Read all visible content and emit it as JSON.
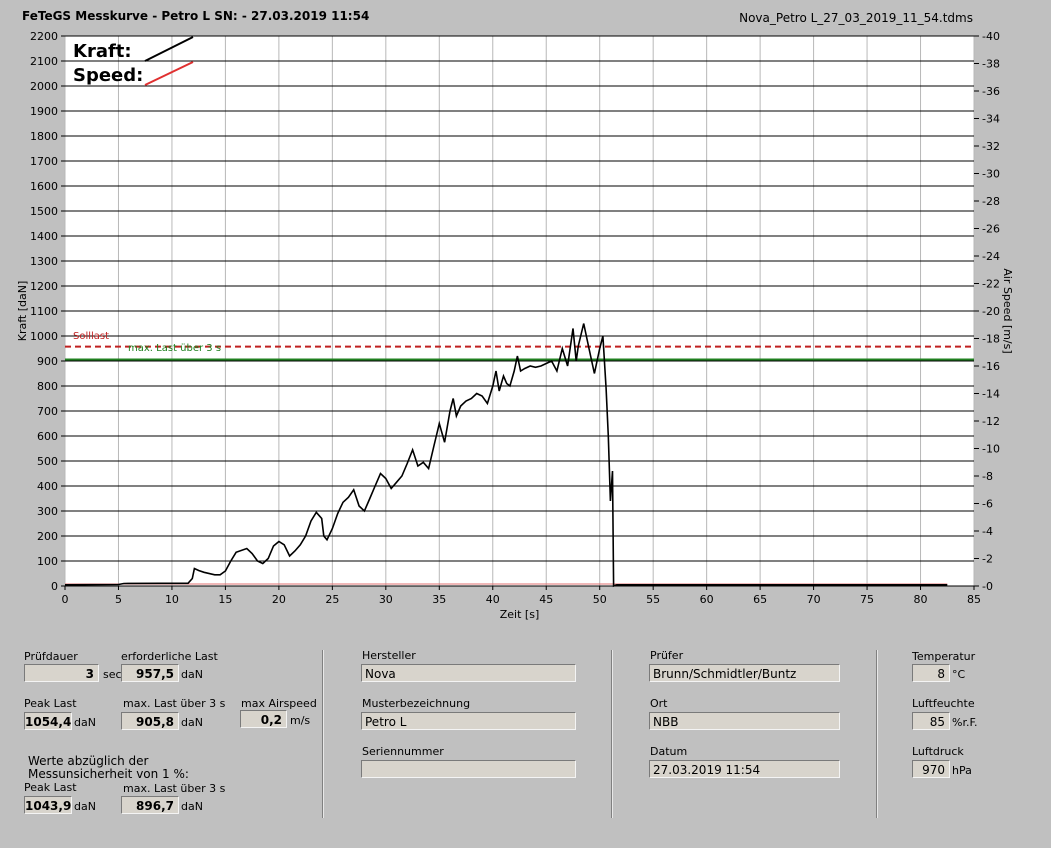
{
  "header": {
    "title": "FeTeGS Messkurve - Petro L  SN:  - 27.03.2019 11:54",
    "filename": "Nova_Petro L_27_03_2019_11_54.tdms"
  },
  "chart_data": {
    "type": "line",
    "xlabel": "Zeit [s]",
    "ylabel": "Kraft [daN]",
    "y2label": "Air Speed [m/s]",
    "xlim": [
      0,
      85
    ],
    "ylim": [
      0,
      2200
    ],
    "y2lim": [
      0,
      40
    ],
    "xticks": [
      0,
      5,
      10,
      15,
      20,
      25,
      30,
      35,
      40,
      45,
      50,
      55,
      60,
      65,
      70,
      75,
      80,
      85
    ],
    "yticks": [
      0,
      100,
      200,
      300,
      400,
      500,
      600,
      700,
      800,
      900,
      1000,
      1100,
      1200,
      1300,
      1400,
      1500,
      1600,
      1700,
      1800,
      1900,
      2000,
      2100,
      2200
    ],
    "y2ticks": [
      0,
      2,
      4,
      6,
      8,
      10,
      12,
      14,
      16,
      18,
      20,
      22,
      24,
      26,
      28,
      30,
      32,
      34,
      36,
      38,
      40
    ],
    "grid": true,
    "legend": [
      {
        "name": "Kraft:",
        "color": "#000000"
      },
      {
        "name": "Speed:",
        "color": "#e03030"
      }
    ],
    "reference_lines": [
      {
        "name": "Solllast",
        "y": 957.5,
        "color": "#c02020",
        "style": "dashed"
      },
      {
        "name": "max. Last über  3 s",
        "y": 905.8,
        "color": "#208020",
        "style": "solid"
      }
    ],
    "series": [
      {
        "name": "Kraft:",
        "color": "#000000",
        "points": [
          [
            0,
            5
          ],
          [
            5,
            6
          ],
          [
            5.5,
            10
          ],
          [
            9,
            11
          ],
          [
            11.5,
            11
          ],
          [
            11.9,
            30
          ],
          [
            12.1,
            70
          ],
          [
            12.5,
            62
          ],
          [
            13,
            55
          ],
          [
            14,
            45
          ],
          [
            14.5,
            45
          ],
          [
            15,
            60
          ],
          [
            15.5,
            100
          ],
          [
            16,
            135
          ],
          [
            17,
            150
          ],
          [
            17.5,
            130
          ],
          [
            18,
            100
          ],
          [
            18.5,
            90
          ],
          [
            19,
            110
          ],
          [
            19.5,
            160
          ],
          [
            20,
            178
          ],
          [
            20.5,
            165
          ],
          [
            21,
            120
          ],
          [
            21.5,
            140
          ],
          [
            22,
            165
          ],
          [
            22.5,
            200
          ],
          [
            23,
            260
          ],
          [
            23.5,
            295
          ],
          [
            24,
            270
          ],
          [
            24.2,
            200
          ],
          [
            24.5,
            185
          ],
          [
            25,
            230
          ],
          [
            25.5,
            290
          ],
          [
            26,
            335
          ],
          [
            26.5,
            355
          ],
          [
            27,
            385
          ],
          [
            27.5,
            320
          ],
          [
            28,
            300
          ],
          [
            28.5,
            350
          ],
          [
            29,
            400
          ],
          [
            29.5,
            450
          ],
          [
            30,
            430
          ],
          [
            30.5,
            390
          ],
          [
            31,
            415
          ],
          [
            31.5,
            440
          ],
          [
            32,
            490
          ],
          [
            32.5,
            545
          ],
          [
            33,
            480
          ],
          [
            33.5,
            495
          ],
          [
            34,
            470
          ],
          [
            34.5,
            560
          ],
          [
            35,
            650
          ],
          [
            35.5,
            575
          ],
          [
            36,
            700
          ],
          [
            36.3,
            750
          ],
          [
            36.6,
            680
          ],
          [
            37,
            720
          ],
          [
            37.5,
            740
          ],
          [
            38,
            750
          ],
          [
            38.5,
            770
          ],
          [
            39,
            760
          ],
          [
            39.5,
            730
          ],
          [
            40,
            800
          ],
          [
            40.3,
            860
          ],
          [
            40.6,
            780
          ],
          [
            41,
            840
          ],
          [
            41.3,
            810
          ],
          [
            41.6,
            800
          ],
          [
            42,
            860
          ],
          [
            42.3,
            920
          ],
          [
            42.6,
            860
          ],
          [
            43,
            870
          ],
          [
            43.5,
            880
          ],
          [
            44,
            875
          ],
          [
            44.5,
            880
          ],
          [
            45,
            890
          ],
          [
            45.5,
            900
          ],
          [
            46,
            860
          ],
          [
            46.5,
            950
          ],
          [
            47,
            880
          ],
          [
            47.5,
            1030
          ],
          [
            47.8,
            900
          ],
          [
            48,
            960
          ],
          [
            48.5,
            1050
          ],
          [
            49,
            950
          ],
          [
            49.5,
            850
          ],
          [
            50,
            950
          ],
          [
            50.3,
            1000
          ],
          [
            50.6,
            790
          ],
          [
            50.8,
            600
          ],
          [
            51,
            340
          ],
          [
            51.2,
            460
          ],
          [
            51.3,
            0
          ],
          [
            51.6,
            5
          ],
          [
            82.5,
            5
          ]
        ]
      }
    ]
  },
  "panel": {
    "pruefdauer": {
      "label": "Prüfdauer",
      "value": "3",
      "unit": "sec"
    },
    "erforderliche_last": {
      "label": "erforderliche Last",
      "value": "957,5",
      "unit": "daN"
    },
    "peak_last": {
      "label": "Peak Last",
      "value": "1054,4",
      "unit": "daN"
    },
    "max_last_3s": {
      "label": "max. Last über  3 s",
      "value": "905,8",
      "unit": "daN"
    },
    "max_airspeed": {
      "label": "max Airspeed",
      "value": "0,2",
      "unit": "m/s"
    },
    "note_line1": "Werte abzüglich der",
    "note_line2": "Messunsicherheit von 1  %:",
    "peak_last_adj": {
      "label": "Peak Last",
      "value": "1043,9",
      "unit": "daN"
    },
    "max_last_3s_adj": {
      "label": "max. Last über  3 s",
      "value": "896,7",
      "unit": "daN"
    },
    "hersteller": {
      "label": "Hersteller",
      "value": "Nova"
    },
    "musterbezeichnung": {
      "label": "Musterbezeichnung",
      "value": "Petro L"
    },
    "seriennummer": {
      "label": "Seriennummer",
      "value": ""
    },
    "pruefer": {
      "label": "Prüfer",
      "value": "Brunn/Schmidtler/Buntz"
    },
    "ort": {
      "label": "Ort",
      "value": "NBB"
    },
    "datum": {
      "label": "Datum",
      "value": "27.03.2019 11:54"
    },
    "temperatur": {
      "label": "Temperatur",
      "value": "8",
      "unit": "°C"
    },
    "luftfeuchte": {
      "label": "Luftfeuchte",
      "value": "85",
      "unit": "%r.F."
    },
    "luftdruck": {
      "label": "Luftdruck",
      "value": "970",
      "unit": "hPa"
    }
  }
}
